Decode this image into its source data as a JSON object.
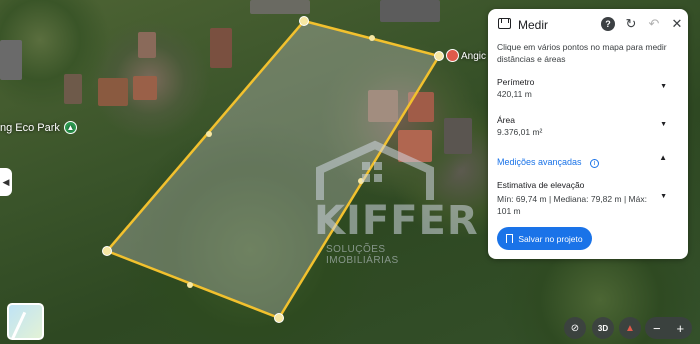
{
  "map": {
    "park_label": "ng Eco Park",
    "place_label": "Angic"
  },
  "watermark": {
    "brand": "KIFFER",
    "tagline": "SOLUÇÕES IMOBILIÁRIAS"
  },
  "panel": {
    "title": "Medir",
    "instructions": "Clique em vários pontos no mapa para medir distâncias e áreas",
    "perimeter": {
      "label": "Perímetro",
      "value": "420,11 m"
    },
    "area": {
      "label": "Área",
      "value": "9.376,01 m²"
    },
    "advanced_label": "Medições avançadas",
    "elevation": {
      "label": "Estimativa de elevação",
      "value": "Mín: 69,74 m | Mediana: 79,82 m | Máx: 101 m"
    },
    "save_label": "Salvar no projeto"
  },
  "controls": {
    "view_3d": "3D",
    "zoom_out": "−",
    "zoom_in": "+"
  }
}
